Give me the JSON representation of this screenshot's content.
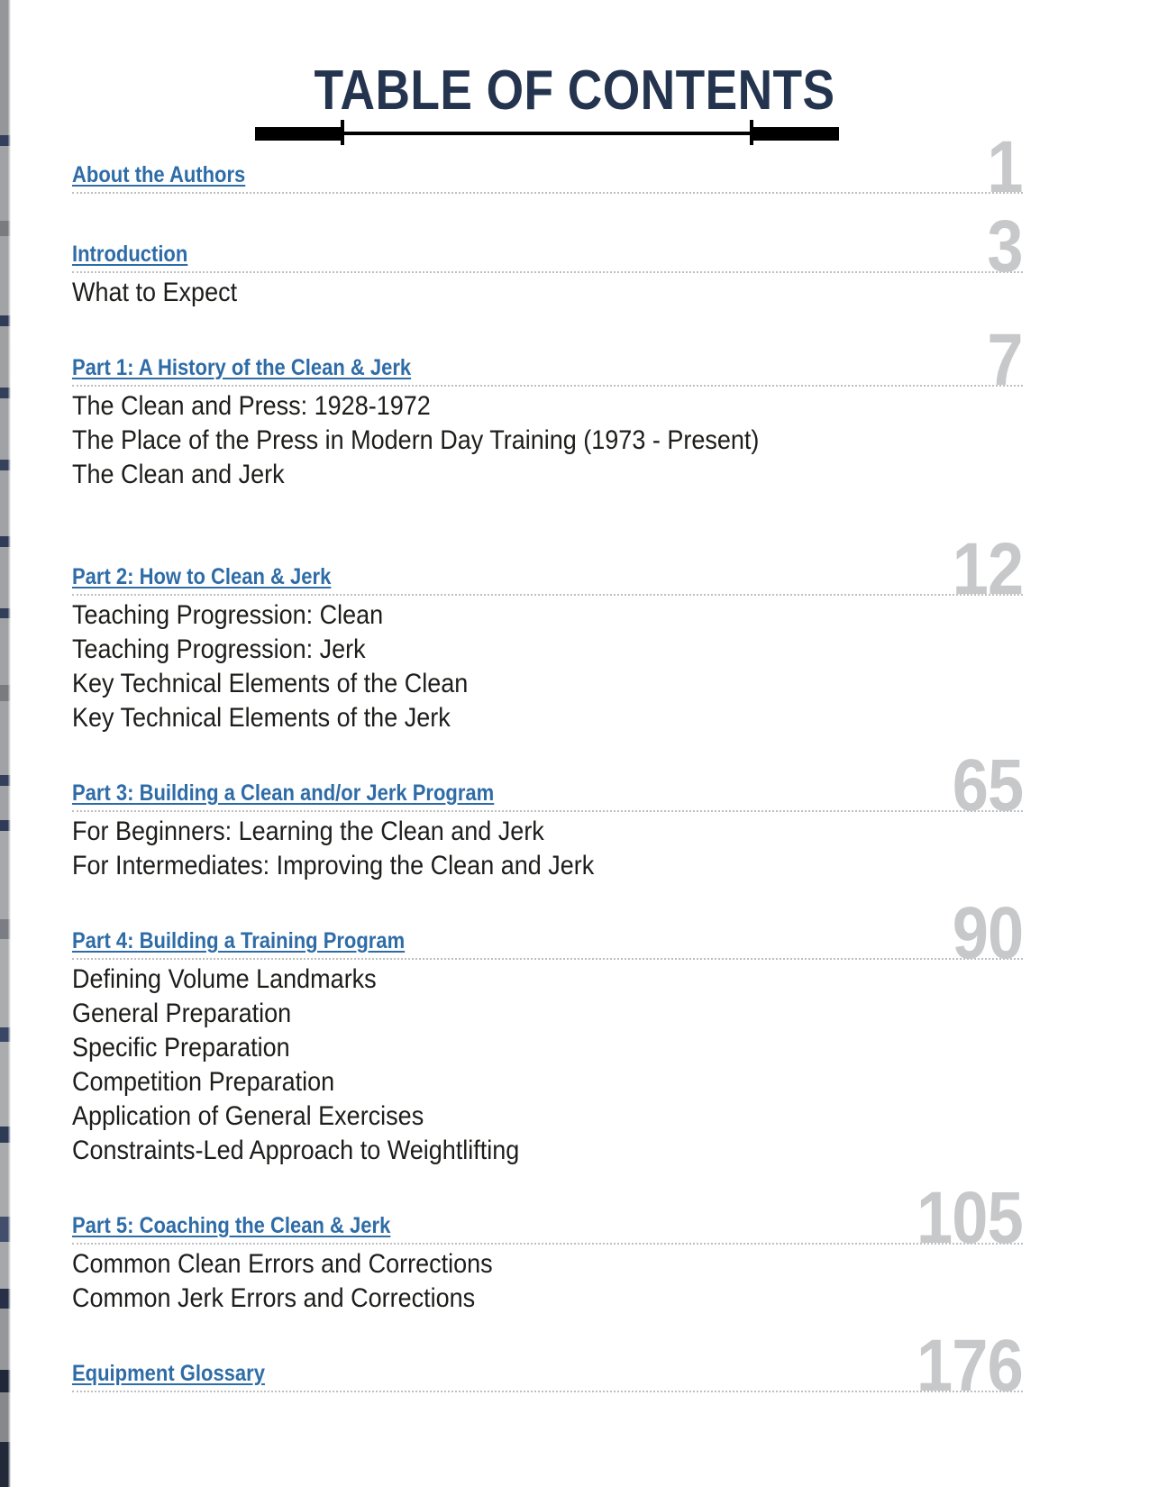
{
  "page": {
    "title": "TABLE OF CONTENTS",
    "divider_icon": "barbell-icon",
    "colors": {
      "title_navy": "#24344F",
      "heading_blue": "#2E6CA7",
      "page_number_gray": "#C7C8CA",
      "body_text": "#1D1D1B",
      "leader_dots": "#BFBFBF"
    }
  },
  "sections": [
    {
      "heading": "About the Authors",
      "page": "1",
      "items": []
    },
    {
      "heading": "Introduction",
      "page": "3",
      "items": [
        "What to Expect"
      ]
    },
    {
      "heading": "Part 1: A History of the Clean & Jerk",
      "page": "7",
      "items": [
        "The Clean and Press: 1928-1972",
        "The Place of the Press in Modern Day Training (1973 - Present)",
        "The Clean and Jerk"
      ]
    },
    {
      "heading": "Part 2: How to Clean & Jerk",
      "page": "12",
      "items": [
        "Teaching Progression: Clean",
        "Teaching Progression: Jerk",
        "Key Technical Elements of the Clean",
        "Key Technical Elements of the Jerk"
      ]
    },
    {
      "heading": "Part 3: Building a Clean and/or Jerk Program",
      "page": "65",
      "items": [
        "For Beginners: Learning the Clean and Jerk",
        "For Intermediates: Improving the Clean and Jerk"
      ]
    },
    {
      "heading": "Part 4: Building a Training Program",
      "page": "90",
      "items": [
        "Defining Volume Landmarks",
        "General Preparation",
        "Specific Preparation",
        "Competition Preparation",
        "Application of General Exercises",
        "Constraints-Led Approach to Weightlifting"
      ]
    },
    {
      "heading": "Part 5: Coaching the Clean & Jerk",
      "page": "105",
      "items": [
        "Common Clean Errors and Corrections",
        "Common Jerk Errors and Corrections"
      ]
    },
    {
      "heading": "Equipment Glossary",
      "page": "176",
      "items": []
    }
  ]
}
